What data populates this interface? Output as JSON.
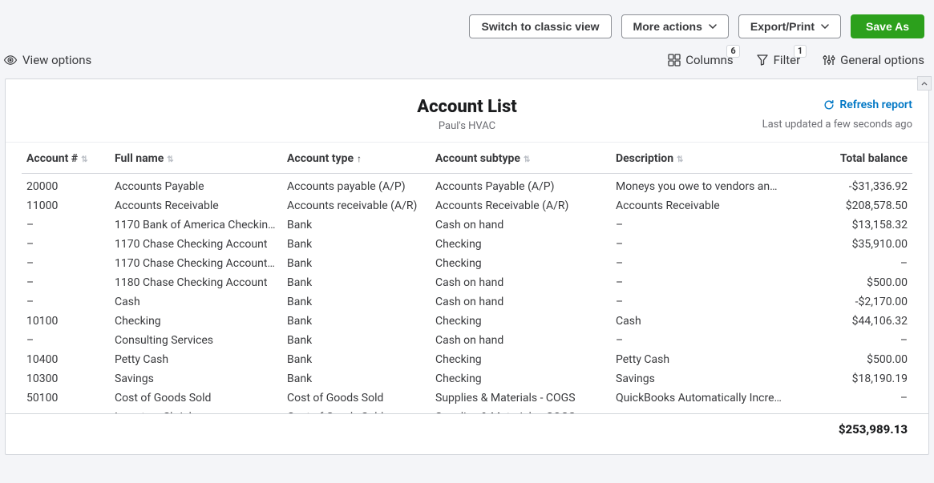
{
  "topBar": {
    "classicView": "Switch to classic view",
    "moreActions": "More actions",
    "exportPrint": "Export/Print",
    "saveAs": "Save As"
  },
  "toolbar": {
    "viewOptions": "View options",
    "columns": "Columns",
    "columnsBadge": "6",
    "filter": "Filter",
    "filterBadge": "1",
    "generalOptions": "General options"
  },
  "report": {
    "title": "Account List",
    "company": "Paul's HVAC",
    "refresh": "Refresh report",
    "lastUpdated": "Last updated a few seconds ago",
    "total": "$253,989.13"
  },
  "columns": {
    "accountNum": "Account #",
    "fullName": "Full name",
    "accountType": "Account type",
    "accountSubtype": "Account subtype",
    "description": "Description",
    "totalBalance": "Total balance"
  },
  "rows": [
    {
      "num": "20000",
      "name": "Accounts Payable",
      "type": "Accounts payable (A/P)",
      "subtype": "Accounts Payable (A/P)",
      "desc": "Moneys you owe to vendors an…",
      "balance": "-$31,336.92"
    },
    {
      "num": "11000",
      "name": "Accounts Receivable",
      "type": "Accounts receivable (A/R)",
      "subtype": "Accounts Receivable (A/R)",
      "desc": "Accounts Receivable",
      "balance": "$208,578.50"
    },
    {
      "num": "–",
      "name": "1170 Bank of America Checkin…",
      "type": "Bank",
      "subtype": "Cash on hand",
      "desc": "–",
      "balance": "$13,158.32"
    },
    {
      "num": "–",
      "name": "1170 Chase Checking Account",
      "type": "Bank",
      "subtype": "Checking",
      "desc": "–",
      "balance": "$35,910.00"
    },
    {
      "num": "–",
      "name": "1170 Chase Checking Account:…",
      "type": "Bank",
      "subtype": "Checking",
      "desc": "–",
      "balance": "–"
    },
    {
      "num": "–",
      "name": "1180 Chase Checking Account",
      "type": "Bank",
      "subtype": "Cash on hand",
      "desc": "–",
      "balance": "$500.00"
    },
    {
      "num": "–",
      "name": "Cash",
      "type": "Bank",
      "subtype": "Cash on hand",
      "desc": "–",
      "balance": "-$2,170.00"
    },
    {
      "num": "10100",
      "name": "Checking",
      "type": "Bank",
      "subtype": "Checking",
      "desc": "Cash",
      "balance": "$44,106.32"
    },
    {
      "num": "–",
      "name": "Consulting Services",
      "type": "Bank",
      "subtype": "Cash on hand",
      "desc": "–",
      "balance": "–"
    },
    {
      "num": "10400",
      "name": "Petty Cash",
      "type": "Bank",
      "subtype": "Checking",
      "desc": "Petty Cash",
      "balance": "$500.00"
    },
    {
      "num": "10300",
      "name": "Savings",
      "type": "Bank",
      "subtype": "Checking",
      "desc": "Savings",
      "balance": "$18,190.19"
    },
    {
      "num": "50100",
      "name": "Cost of Goods Sold",
      "type": "Cost of Goods Sold",
      "subtype": "Supplies & Materials - COGS",
      "desc": "QuickBooks Automatically Incre…",
      "balance": "–"
    },
    {
      "num": "–",
      "name": "Inventory Shrinkage",
      "type": "Cost of Goods Sold",
      "subtype": "Supplies & Materials - COGS",
      "desc": "–",
      "balance": "–"
    }
  ]
}
